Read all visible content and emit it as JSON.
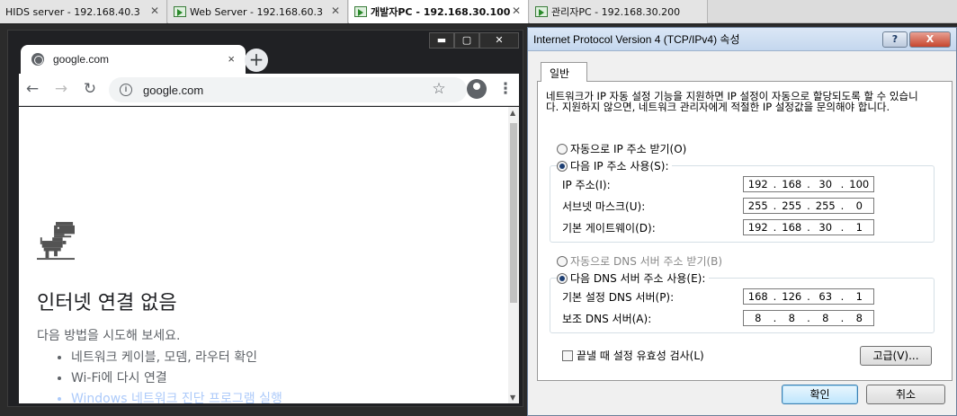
{
  "vm_tabs": [
    {
      "label": "HIDS server - 192.168.40.3",
      "active": false
    },
    {
      "label": "Web Server - 192.168.60.3",
      "active": false
    },
    {
      "label": "개발자PC - 192.168.30.100",
      "active": true
    },
    {
      "label": "관리자PC - 192.168.30.200",
      "active": false
    }
  ],
  "chrome": {
    "tab_title": "google.com",
    "tab_close": "×",
    "new_tab": "+",
    "address": "google.com",
    "window_controls": [
      "▬",
      "▢",
      "✕"
    ],
    "error": {
      "title": "인터넷 연결 없음",
      "subtitle": "다음 방법을 시도해 보세요.",
      "suggestions": [
        "네트워크 케이블, 모뎀, 라우터 확인",
        "Wi-Fi에 다시 연결",
        "Windows 네트워크 진단 프로그램 실행"
      ]
    }
  },
  "dialog": {
    "title": "Internet Protocol Version 4 (TCP/IPv4) 속성",
    "help": "?",
    "close": "X",
    "tab": "일반",
    "description": "네트워크가 IP 자동 설정 기능을 지원하면 IP 설정이 자동으로 할당되도록 할 수 있습니다. 지원하지 않으면, 네트워크 관리자에게 적절한 IP 설정값을 문의해야 합니다.",
    "ip_auto": "자동으로 IP 주소 받기(O)",
    "ip_manual": "다음 IP 주소 사용(S):",
    "ip_label": "IP 주소(I):",
    "ip_value": [
      "192",
      "168",
      "30",
      "100"
    ],
    "mask_label": "서브넷 마스크(U):",
    "mask_value": [
      "255",
      "255",
      "255",
      "0"
    ],
    "gw_label": "기본 게이트웨이(D):",
    "gw_value": [
      "192",
      "168",
      "30",
      "1"
    ],
    "dns_auto": "자동으로 DNS 서버 주소 받기(B)",
    "dns_manual": "다음 DNS 서버 주소 사용(E):",
    "dns1_label": "기본 설정 DNS 서버(P):",
    "dns1_value": [
      "168",
      "126",
      "63",
      "1"
    ],
    "dns2_label": "보조 DNS 서버(A):",
    "dns2_value": [
      "8",
      "8",
      "8",
      "8"
    ],
    "validate_label": "끝낼 때 설정 유효성 검사(L)",
    "advanced_button": "고급(V)...",
    "ok_button": "확인",
    "cancel_button": "취소"
  }
}
